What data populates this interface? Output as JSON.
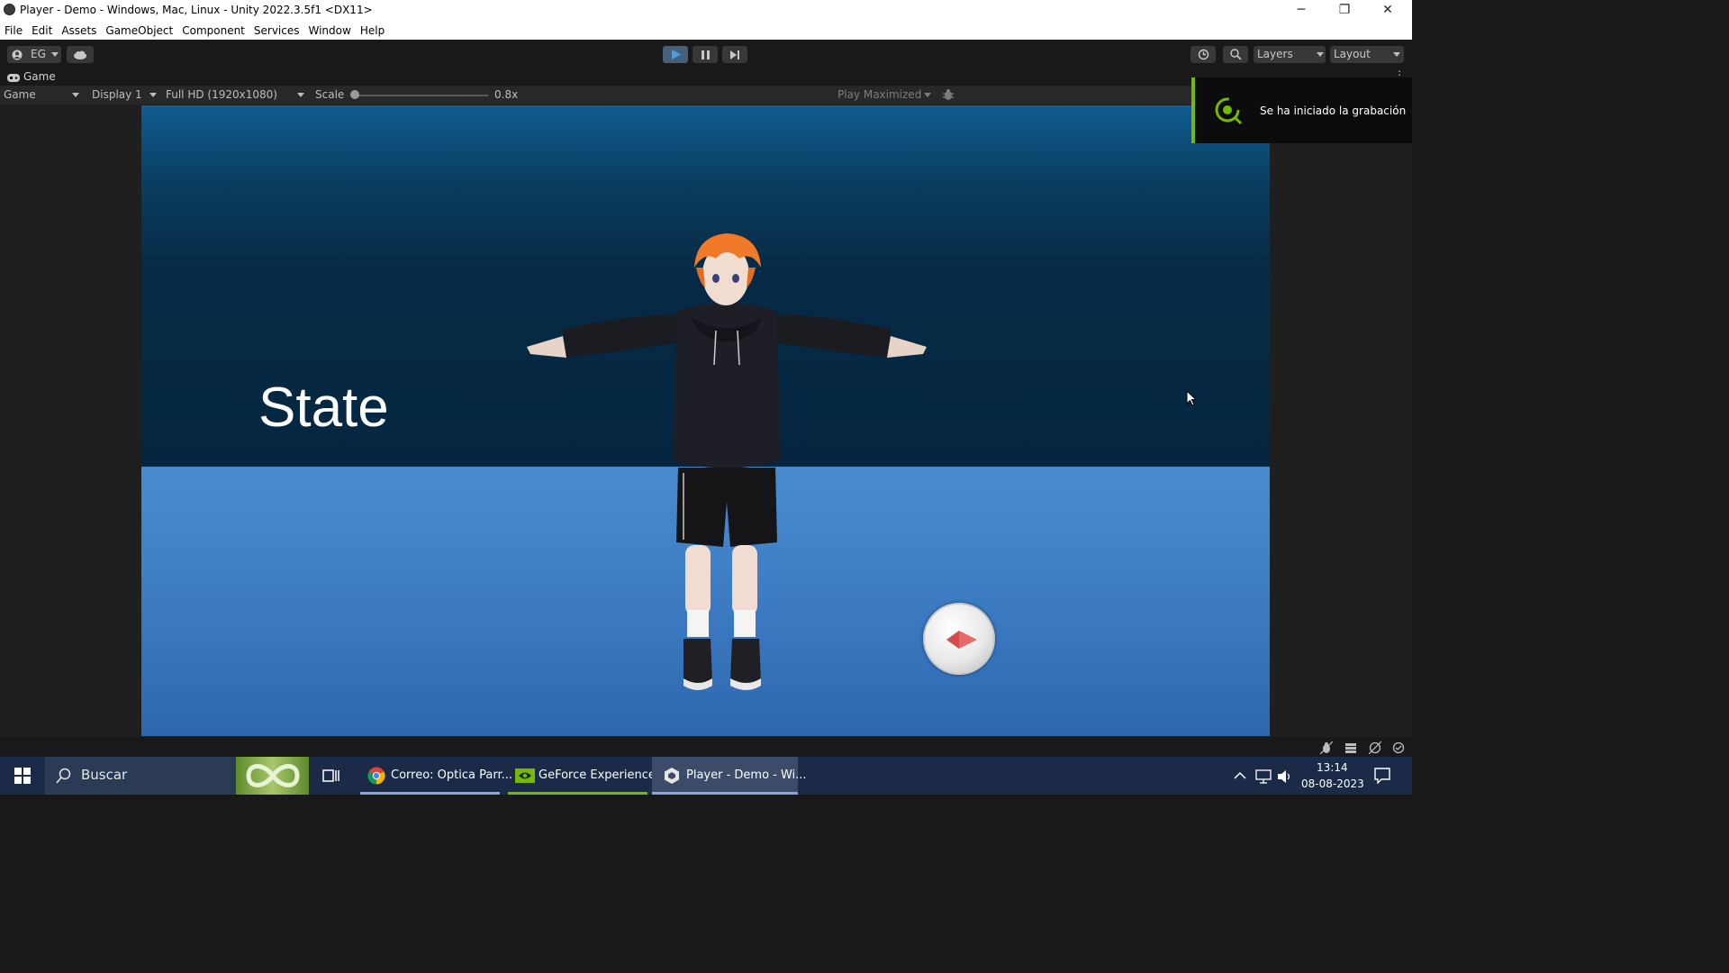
{
  "window": {
    "title": "Player - Demo - Windows, Mac, Linux - Unity 2022.3.5f1 <DX11>",
    "minimize_glyph": "─",
    "maximize_glyph": "❐",
    "close_glyph": "✕"
  },
  "menu": [
    "File",
    "Edit",
    "Assets",
    "GameObject",
    "Component",
    "Services",
    "Window",
    "Help"
  ],
  "toolbar": {
    "account_label": "EG",
    "layers_label": "Layers",
    "layout_label": "Layout"
  },
  "game_tab": {
    "tab_label": "Game",
    "view_mode": "Game",
    "display": "Display 1",
    "resolution": "Full HD (1920x1080)",
    "scale_label": "Scale",
    "scale_value": "0.8x",
    "play_mode_label": "Play Maximized"
  },
  "scene": {
    "state_text": "State"
  },
  "notification": {
    "text": "Se ha iniciado la grabación"
  },
  "taskbar": {
    "search_placeholder": "Buscar",
    "chrome_label": "Correo: Optica Parr...",
    "geforce_label": "GeForce Experience",
    "unity_label": "Player - Demo - Wi...",
    "time": "13:14",
    "date": "08-08-2023"
  },
  "colors": {
    "nvidia_green": "#76b900",
    "unity_dark": "#191919",
    "taskbar": "#1a2a47",
    "play_blue": "#4f9dde"
  }
}
